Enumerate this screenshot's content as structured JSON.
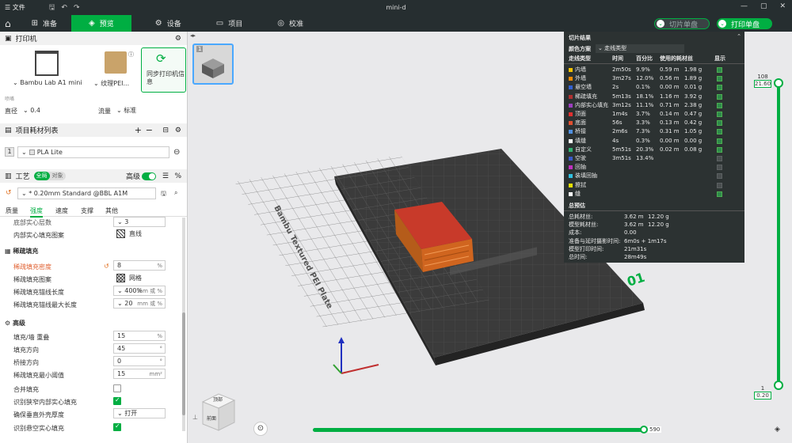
{
  "titlebar": {
    "menu": "☰ 文件",
    "title": "mini-d"
  },
  "tabs": [
    {
      "label": "准备",
      "icon": "⊞"
    },
    {
      "label": "预览",
      "icon": "◈"
    },
    {
      "label": "设备",
      "icon": "⚙"
    },
    {
      "label": "项目",
      "icon": "▭"
    },
    {
      "label": "校准",
      "icon": "◎"
    }
  ],
  "actions": {
    "slice": "切片单盘",
    "print": "打印单盘"
  },
  "printer": {
    "section": "打印机",
    "name": "Bambu Lab A1 mini",
    "plate": "纹理PEI...",
    "sync": "同步打印机信息",
    "nozzle_label": "喷嘴",
    "diameter_label": "直径",
    "diameter": "0.4",
    "flow_label": "流量",
    "flow": "标准"
  },
  "filaments": {
    "section": "项目耗材列表",
    "index": "1",
    "name": "PLA Lite"
  },
  "process": {
    "section": "工艺",
    "toggle_global": "全局",
    "toggle_object": "对象",
    "advanced": "高级",
    "preset": "* 0.20mm Standard @BBL A1M",
    "subtabs": [
      "质量",
      "强度",
      "速度",
      "支撑",
      "其他"
    ]
  },
  "strength": {
    "top_items": [
      {
        "label": "底部实心层数",
        "value": "3"
      },
      {
        "label": "内部实心填充图案",
        "value": "直线"
      }
    ],
    "sparse_title": "稀疏填充",
    "sparse": [
      {
        "label": "稀疏填充密度",
        "value": "8",
        "unit": "%"
      },
      {
        "label": "稀疏填充图案",
        "value": "网格",
        "unit": ""
      },
      {
        "label": "稀疏填充锚线长度",
        "value": "400%",
        "unit": "mm 或 %"
      },
      {
        "label": "稀疏填充锚线最大长度",
        "value": "20",
        "unit": "mm 或 %"
      }
    ],
    "adv_title": "高级",
    "adv": [
      {
        "label": "填充/墙 重叠",
        "value": "15",
        "unit": "%"
      },
      {
        "label": "填充方向",
        "value": "45",
        "unit": "°"
      },
      {
        "label": "桥接方向",
        "value": "0",
        "unit": "°"
      },
      {
        "label": "稀疏填充最小阈值",
        "value": "15",
        "unit": "mm²"
      }
    ],
    "checks": [
      {
        "label": "合并填充",
        "on": false
      },
      {
        "label": "识别狭窄内部实心填充",
        "on": true
      },
      {
        "label": "确保垂直外壳厚度",
        "value": "打开"
      },
      {
        "label": "识别悬空实心填充",
        "on": true
      }
    ]
  },
  "plate": {
    "number": "1",
    "bed_text": "Bambu Textured PEI Plate",
    "plate_no": "01"
  },
  "results": {
    "title": "切片结果",
    "scheme_label": "颜色方案",
    "scheme": "走线类型",
    "headers": [
      "走线类型",
      "时间",
      "百分比",
      "使用的耗材丝",
      "显示"
    ],
    "rows": [
      {
        "name": "内墙",
        "color": "#f2c200",
        "time": "2m50s",
        "pct": "9.9%",
        "len": "0.59 m",
        "g": "1.98 g",
        "show": true
      },
      {
        "name": "外墙",
        "color": "#f08a00",
        "time": "3m27s",
        "pct": "12.0%",
        "len": "0.56 m",
        "g": "1.89 g",
        "show": true
      },
      {
        "name": "悬空墙",
        "color": "#3260d0",
        "time": "2s",
        "pct": "0.1%",
        "len": "0.00 m",
        "g": "0.01 g",
        "show": true
      },
      {
        "name": "稀疏填充",
        "color": "#b03030",
        "time": "5m13s",
        "pct": "18.1%",
        "len": "1.16 m",
        "g": "3.92 g",
        "show": true
      },
      {
        "name": "内部实心填充",
        "color": "#9b3fbf",
        "time": "3m12s",
        "pct": "11.1%",
        "len": "0.71 m",
        "g": "2.38 g",
        "show": true
      },
      {
        "name": "顶面",
        "color": "#e03030",
        "time": "1m4s",
        "pct": "3.7%",
        "len": "0.14 m",
        "g": "0.47 g",
        "show": true
      },
      {
        "name": "底面",
        "color": "#e05030",
        "time": "56s",
        "pct": "3.3%",
        "len": "0.13 m",
        "g": "0.42 g",
        "show": true
      },
      {
        "name": "桥接",
        "color": "#5090e0",
        "time": "2m6s",
        "pct": "7.3%",
        "len": "0.31 m",
        "g": "1.05 g",
        "show": true
      },
      {
        "name": "填缝",
        "color": "#ffffff",
        "time": "4s",
        "pct": "0.3%",
        "len": "0.00 m",
        "g": "0.00 g",
        "show": true
      },
      {
        "name": "自定义",
        "color": "#30b070",
        "time": "5m51s",
        "pct": "20.3%",
        "len": "0.02 m",
        "g": "0.08 g",
        "show": true
      },
      {
        "name": "空驶",
        "color": "#3a5ac8",
        "time": "3m51s",
        "pct": "13.4%",
        "len": "",
        "g": "",
        "show": false
      },
      {
        "name": "回抽",
        "color": "#c030c0",
        "time": "",
        "pct": "",
        "len": "",
        "g": "",
        "show": false
      },
      {
        "name": "装填回抽",
        "color": "#30c0e0",
        "time": "",
        "pct": "",
        "len": "",
        "g": "",
        "show": false
      },
      {
        "name": "擦拭",
        "color": "#e8e000",
        "time": "",
        "pct": "",
        "len": "",
        "g": "",
        "show": false
      },
      {
        "name": "缝",
        "color": "#ffffff",
        "time": "",
        "pct": "",
        "len": "",
        "g": "",
        "show": true
      }
    ],
    "summary_title": "总预估",
    "summary": [
      {
        "label": "总耗材丝:",
        "a": "3.62 m",
        "b": "12.20 g"
      },
      {
        "label": "模型耗材丝:",
        "a": "3.62 m",
        "b": "12.20 g"
      },
      {
        "label": "成本:",
        "a": "0.00",
        "b": ""
      },
      {
        "label": "准备与延时摄影时间:",
        "a": "6m0s + 1m17s",
        "b": ""
      },
      {
        "label": "模型打印时间:",
        "a": "21m31s",
        "b": ""
      },
      {
        "label": "总时间:",
        "a": "28m49s",
        "b": ""
      }
    ]
  },
  "layer_slider": {
    "top_layer": "108",
    "top_height": "21.60",
    "bottom_layer": "1",
    "bottom_height": "0.20"
  },
  "move_slider": {
    "value": "590"
  },
  "cube": {
    "top": "顶部",
    "front": "前面"
  }
}
